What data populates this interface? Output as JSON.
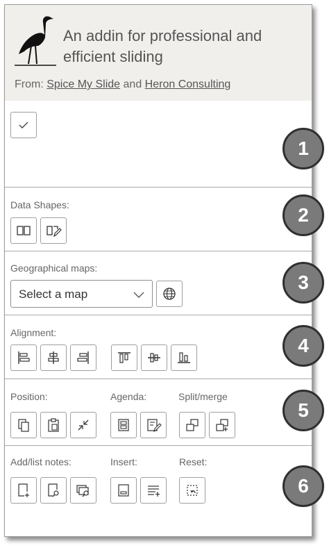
{
  "header": {
    "title": "An addin for professional and efficient sliding",
    "from_label": "From:",
    "link1": "Spice My Slide",
    "and": "and",
    "link2": "Heron Consulting"
  },
  "sections": {
    "data_shapes": "Data Shapes:",
    "geo_maps": "Geographical maps:",
    "map_select_value": "Select a map",
    "alignment": "Alignment:",
    "position": "Position:",
    "agenda": "Agenda:",
    "split_merge": "Split/merge",
    "add_list_notes": "Add/list notes:",
    "insert": "Insert:",
    "reset": "Reset:"
  },
  "markers": [
    "1",
    "2",
    "3",
    "4",
    "5",
    "6"
  ],
  "icons": {
    "check": "check-icon",
    "data_shape_pair": "split-square-icon",
    "data_shape_edit": "edit-shape-icon",
    "globe": "globe-icon"
  }
}
